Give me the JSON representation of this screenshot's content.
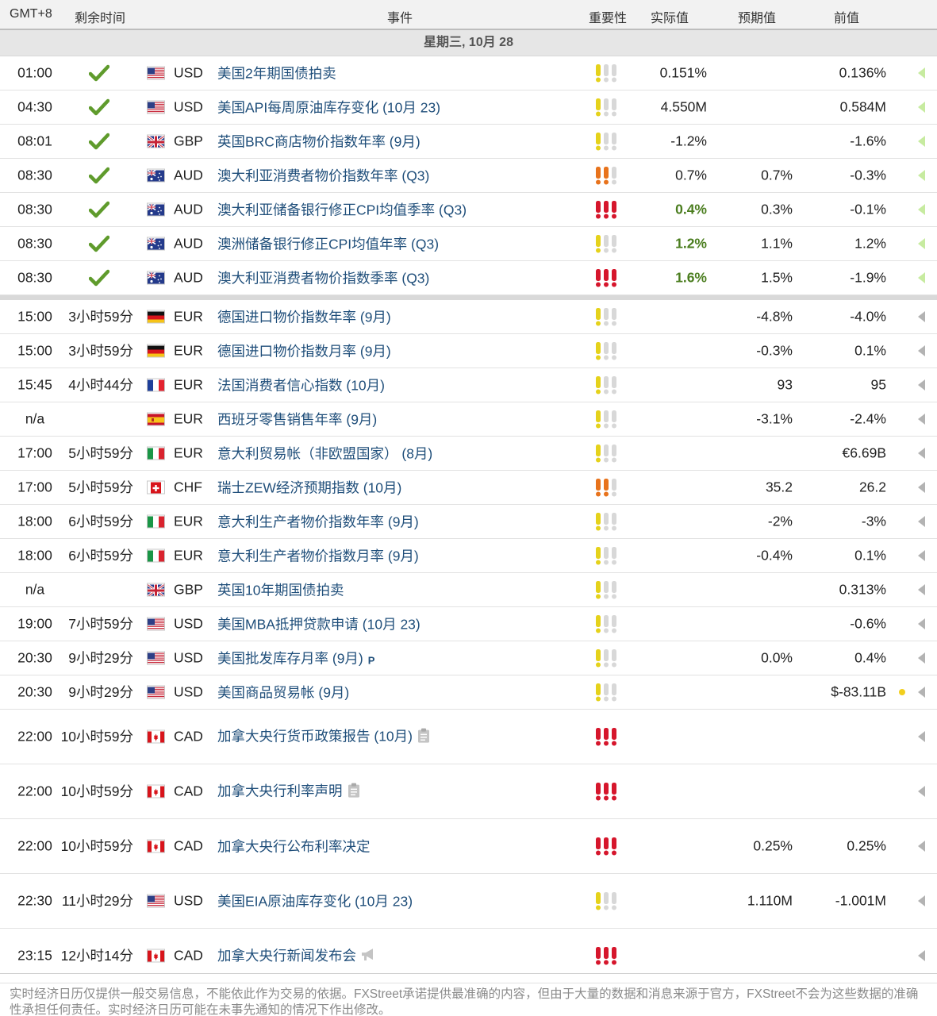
{
  "header": {
    "timezone": "GMT+8",
    "remaining": "剩余时间",
    "event": "事件",
    "importance": "重要性",
    "actual": "实际值",
    "forecast": "预期值",
    "previous": "前值"
  },
  "day": {
    "label": "星期三, 10月 28"
  },
  "colors": {
    "past_arrow": "#c7eba0",
    "future_arrow": "#b3b3b3",
    "good_actual": "#4a7d1e",
    "event_link": "#1f4e7a",
    "high_impact": "#d6162c",
    "medium_impact": "#e8731c",
    "low_impact": "#e5d21b"
  },
  "rows": [
    {
      "time": "01:00",
      "remaining": "",
      "done": true,
      "flag": "us",
      "currency": "USD",
      "event": "美国2年期国债拍卖",
      "icon": "",
      "importance": "low",
      "actual": "0.151%",
      "actual_good": false,
      "forecast": "",
      "previous": "0.136%",
      "past": true,
      "dot": false
    },
    {
      "time": "04:30",
      "remaining": "",
      "done": true,
      "flag": "us",
      "currency": "USD",
      "event": "美国API每周原油库存变化 (10月 23)",
      "icon": "",
      "importance": "low",
      "actual": "4.550M",
      "actual_good": false,
      "forecast": "",
      "previous": "0.584M",
      "past": true,
      "dot": false
    },
    {
      "time": "08:01",
      "remaining": "",
      "done": true,
      "flag": "uk",
      "currency": "GBP",
      "event": "英国BRC商店物价指数年率 (9月)",
      "icon": "",
      "importance": "low",
      "actual": "-1.2%",
      "actual_good": false,
      "forecast": "",
      "previous": "-1.6%",
      "past": true,
      "dot": false
    },
    {
      "time": "08:30",
      "remaining": "",
      "done": true,
      "flag": "au",
      "currency": "AUD",
      "event": "澳大利亚消费者物价指数年率 (Q3)",
      "icon": "",
      "importance": "medium",
      "actual": "0.7%",
      "actual_good": false,
      "forecast": "0.7%",
      "previous": "-0.3%",
      "past": true,
      "dot": false
    },
    {
      "time": "08:30",
      "remaining": "",
      "done": true,
      "flag": "au",
      "currency": "AUD",
      "event": "澳大利亚储备银行修正CPI均值季率 (Q3)",
      "icon": "",
      "importance": "high",
      "actual": "0.4%",
      "actual_good": true,
      "forecast": "0.3%",
      "previous": "-0.1%",
      "past": true,
      "dot": false
    },
    {
      "time": "08:30",
      "remaining": "",
      "done": true,
      "flag": "au",
      "currency": "AUD",
      "event": "澳洲储备银行修正CPI均值年率 (Q3)",
      "icon": "",
      "importance": "low",
      "actual": "1.2%",
      "actual_good": true,
      "forecast": "1.1%",
      "previous": "1.2%",
      "past": true,
      "dot": false
    },
    {
      "time": "08:30",
      "remaining": "",
      "done": true,
      "flag": "au",
      "currency": "AUD",
      "event": "澳大利亚消费者物价指数季率 (Q3)",
      "icon": "",
      "importance": "high",
      "actual": "1.6%",
      "actual_good": true,
      "forecast": "1.5%",
      "previous": "-1.9%",
      "past": true,
      "dot": false,
      "sep_after": true
    },
    {
      "time": "15:00",
      "remaining": "3小时59分",
      "done": false,
      "flag": "de",
      "currency": "EUR",
      "event": "德国进口物价指数年率 (9月)",
      "icon": "",
      "importance": "low",
      "actual": "",
      "actual_good": false,
      "forecast": "-4.8%",
      "previous": "-4.0%",
      "past": false,
      "dot": false
    },
    {
      "time": "15:00",
      "remaining": "3小时59分",
      "done": false,
      "flag": "de",
      "currency": "EUR",
      "event": "德国进口物价指数月率 (9月)",
      "icon": "",
      "importance": "low",
      "actual": "",
      "actual_good": false,
      "forecast": "-0.3%",
      "previous": "0.1%",
      "past": false,
      "dot": false
    },
    {
      "time": "15:45",
      "remaining": "4小时44分",
      "done": false,
      "flag": "fr",
      "currency": "EUR",
      "event": "法国消费者信心指数 (10月)",
      "icon": "",
      "importance": "low",
      "actual": "",
      "actual_good": false,
      "forecast": "93",
      "previous": "95",
      "past": false,
      "dot": false
    },
    {
      "time": "n/a",
      "remaining": "",
      "done": false,
      "flag": "es",
      "currency": "EUR",
      "event": "西班牙零售销售年率 (9月)",
      "icon": "",
      "importance": "low",
      "actual": "",
      "actual_good": false,
      "forecast": "-3.1%",
      "previous": "-2.4%",
      "past": false,
      "dot": false
    },
    {
      "time": "17:00",
      "remaining": "5小时59分",
      "done": false,
      "flag": "it",
      "currency": "EUR",
      "event": "意大利贸易帐（非欧盟国家） (8月)",
      "icon": "",
      "importance": "low",
      "actual": "",
      "actual_good": false,
      "forecast": "",
      "previous": "€6.69B",
      "past": false,
      "dot": false
    },
    {
      "time": "17:00",
      "remaining": "5小时59分",
      "done": false,
      "flag": "ch",
      "currency": "CHF",
      "event": "瑞士ZEW经济预期指数 (10月)",
      "icon": "",
      "importance": "medium",
      "actual": "",
      "actual_good": false,
      "forecast": "35.2",
      "previous": "26.2",
      "past": false,
      "dot": false
    },
    {
      "time": "18:00",
      "remaining": "6小时59分",
      "done": false,
      "flag": "it",
      "currency": "EUR",
      "event": "意大利生产者物价指数年率 (9月)",
      "icon": "",
      "importance": "low",
      "actual": "",
      "actual_good": false,
      "forecast": "-2%",
      "previous": "-3%",
      "past": false,
      "dot": false
    },
    {
      "time": "18:00",
      "remaining": "6小时59分",
      "done": false,
      "flag": "it",
      "currency": "EUR",
      "event": "意大利生产者物价指数月率 (9月)",
      "icon": "",
      "importance": "low",
      "actual": "",
      "actual_good": false,
      "forecast": "-0.4%",
      "previous": "0.1%",
      "past": false,
      "dot": false
    },
    {
      "time": "n/a",
      "remaining": "",
      "done": false,
      "flag": "uk",
      "currency": "GBP",
      "event": "英国10年期国债拍卖",
      "icon": "",
      "importance": "low",
      "actual": "",
      "actual_good": false,
      "forecast": "",
      "previous": "0.313%",
      "past": false,
      "dot": false
    },
    {
      "time": "19:00",
      "remaining": "7小时59分",
      "done": false,
      "flag": "us",
      "currency": "USD",
      "event": "美国MBA抵押贷款申请 (10月 23)",
      "icon": "",
      "importance": "low",
      "actual": "",
      "actual_good": false,
      "forecast": "",
      "previous": "-0.6%",
      "past": false,
      "dot": false
    },
    {
      "time": "20:30",
      "remaining": "9小时29分",
      "done": false,
      "flag": "us",
      "currency": "USD",
      "event": "美国批发库存月率 (9月)",
      "icon": "P",
      "importance": "low",
      "actual": "",
      "actual_good": false,
      "forecast": "0.0%",
      "previous": "0.4%",
      "past": false,
      "dot": false
    },
    {
      "time": "20:30",
      "remaining": "9小时29分",
      "done": false,
      "flag": "us",
      "currency": "USD",
      "event": "美国商品贸易帐 (9月)",
      "icon": "",
      "importance": "low",
      "actual": "",
      "actual_good": false,
      "forecast": "",
      "previous": "$-83.11B",
      "past": false,
      "dot": true
    },
    {
      "time": "22:00",
      "remaining": "10小时59分",
      "done": false,
      "flag": "ca",
      "currency": "CAD",
      "event": "加拿大央行货币政策报告 (10月)",
      "icon": "report",
      "importance": "high",
      "actual": "",
      "actual_good": false,
      "forecast": "",
      "previous": "",
      "past": false,
      "dot": false,
      "tall": true
    },
    {
      "time": "22:00",
      "remaining": "10小时59分",
      "done": false,
      "flag": "ca",
      "currency": "CAD",
      "event": "加拿大央行利率声明",
      "icon": "report",
      "importance": "high",
      "actual": "",
      "actual_good": false,
      "forecast": "",
      "previous": "",
      "past": false,
      "dot": false,
      "tall": true
    },
    {
      "time": "22:00",
      "remaining": "10小时59分",
      "done": false,
      "flag": "ca",
      "currency": "CAD",
      "event": "加拿大央行公布利率决定",
      "icon": "",
      "importance": "high",
      "actual": "",
      "actual_good": false,
      "forecast": "0.25%",
      "previous": "0.25%",
      "past": false,
      "dot": false,
      "tall": true
    },
    {
      "time": "22:30",
      "remaining": "11小时29分",
      "done": false,
      "flag": "us",
      "currency": "USD",
      "event": "美国EIA原油库存变化 (10月 23)",
      "icon": "",
      "importance": "low",
      "actual": "",
      "actual_good": false,
      "forecast": "1.110M",
      "previous": "-1.001M",
      "past": false,
      "dot": false,
      "tall": true
    },
    {
      "time": "23:15",
      "remaining": "12小时14分",
      "done": false,
      "flag": "ca",
      "currency": "CAD",
      "event": "加拿大央行新闻发布会",
      "icon": "speech",
      "importance": "high",
      "actual": "",
      "actual_good": false,
      "forecast": "",
      "previous": "",
      "past": false,
      "dot": false,
      "tall": true
    }
  ],
  "disclaimer": "实时经济日历仅提供一般交易信息，不能依此作为交易的依据。FXStreet承诺提供最准确的内容，但由于大量的数据和消息来源于官方，FXStreet不会为这些数据的准确性承担任何责任。实时经济日历可能在未事先通知的情况下作出修改。"
}
